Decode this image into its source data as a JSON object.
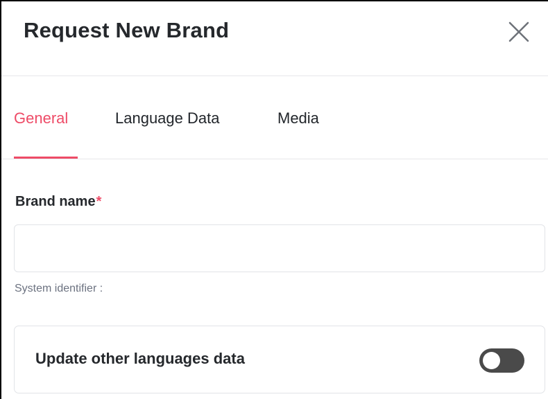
{
  "modal": {
    "title": "Request New Brand",
    "close_icon": "close-icon"
  },
  "tabs": [
    {
      "label": "General",
      "active": true
    },
    {
      "label": "Language Data",
      "active": false
    },
    {
      "label": "Media",
      "active": false
    }
  ],
  "brand_name": {
    "label": "Brand name",
    "required_mark": "*",
    "value": "",
    "helper": "System identifier :"
  },
  "update_languages": {
    "label": "Update other languages data",
    "enabled": false
  },
  "colors": {
    "accent": "#ee4b67",
    "toggle_off": "#4a4a4a"
  }
}
